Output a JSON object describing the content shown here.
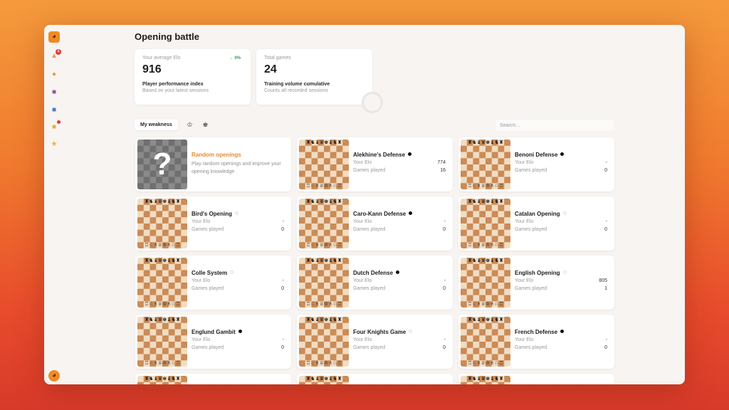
{
  "sidebar": {
    "logo": "logo-icon",
    "notification_count": "4",
    "icons": [
      "bell-icon",
      "user-icon",
      "home-icon",
      "book-icon",
      "folder-icon",
      "star-icon"
    ],
    "bottom": "avatar-icon"
  },
  "page": {
    "title": "Opening battle"
  },
  "stats": {
    "elo": {
      "label": "Your average Elo",
      "value": "916",
      "trend": "→ 0%",
      "title": "Player performance index",
      "subtitle": "Based on your latest sessions"
    },
    "games": {
      "label": "Total games",
      "value": "24",
      "title": "Training volume cumulative",
      "subtitle": "Counts all recorded sessions"
    }
  },
  "filters": {
    "weakness_label": "My weakness",
    "white_icon": "white-pieces-icon",
    "black_icon": "black-pieces-icon",
    "search_placeholder": "Search..."
  },
  "labels": {
    "elo": "Your Elo",
    "games": "Games played"
  },
  "colors": {
    "accent": "#e48a2c",
    "black_dot": "#111111",
    "white_dot": "#ffffff"
  },
  "random": {
    "name": "Random openings",
    "desc": "Play random openings and improve your opening knowledge",
    "glyph": "?"
  },
  "openings": [
    {
      "name": "Alekhine's Defense",
      "side": "black",
      "elo": "774",
      "games": "16"
    },
    {
      "name": "Benoni Defense",
      "side": "black",
      "elo": "-",
      "games": "0"
    },
    {
      "name": "Bird's Opening",
      "side": "white",
      "elo": "-",
      "games": "0"
    },
    {
      "name": "Caro-Kann Defense",
      "side": "black",
      "elo": "-",
      "games": "0"
    },
    {
      "name": "Catalan Opening",
      "side": "white",
      "elo": "-",
      "games": "0"
    },
    {
      "name": "Colle System",
      "side": "white",
      "elo": "-",
      "games": "0"
    },
    {
      "name": "Dutch Defense",
      "side": "black",
      "elo": "-",
      "games": "0"
    },
    {
      "name": "English Opening",
      "side": "white",
      "elo": "805",
      "games": "1"
    },
    {
      "name": "Englund Gambit",
      "side": "black",
      "elo": "-",
      "games": "0"
    },
    {
      "name": "Four Knights Game",
      "side": "white",
      "elo": "-",
      "games": "0"
    },
    {
      "name": "French Defense",
      "side": "black",
      "elo": "-",
      "games": "0"
    }
  ]
}
